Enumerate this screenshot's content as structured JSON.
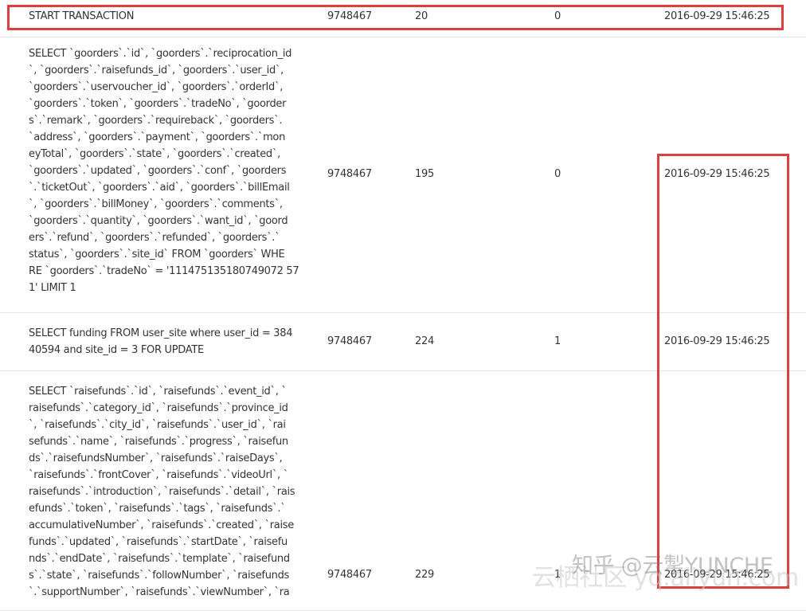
{
  "rows": [
    {
      "sql": [
        "START TRANSACTION"
      ],
      "thread_id": "9748467",
      "time": "20",
      "flag": "0",
      "date": "2016-09-29 15:46:25"
    },
    {
      "sql": [
        "SELECT `goorders`.`id`, `goorders`.`reciprocation_id",
        "`, `goorders`.`raisefunds_id`, `goorders`.`user_id`,",
        "`goorders`.`uservoucher_id`, `goorders`.`orderId`,",
        "`goorders`.`token`, `goorders`.`tradeNo`, `goorder",
        "s`.`remark`, `goorders`.`requireback`, `goorders`.",
        "`address`, `goorders`.`payment`, `goorders`.`mon",
        "eyTotal`, `goorders`.`state`, `goorders`.`created`,",
        "`goorders`.`updated`, `goorders`.`conf`, `goorders",
        "`.`ticketOut`, `goorders`.`aid`, `goorders`.`billEmail",
        "`, `goorders`.`billMoney`, `goorders`.`comments`,",
        "`goorders`.`quantity`, `goorders`.`want_id`, `goord",
        "ers`.`refund`, `goorders`.`refunded`, `goorders`.`",
        "status`, `goorders`.`site_id` FROM `goorders` WHE",
        "RE `goorders`.`tradeNo` = '111475135180749072 57",
        "1' LIMIT 1"
      ],
      "thread_id": "9748467",
      "time": "195",
      "flag": "0",
      "date": "2016-09-29 15:46:25"
    },
    {
      "sql": [
        "SELECT funding FROM user_site where user_id = 384",
        "40594 and site_id = 3 FOR UPDATE"
      ],
      "thread_id": "9748467",
      "time": "224",
      "flag": "1",
      "date": "2016-09-29 15:46:25"
    },
    {
      "sql": [
        "SELECT `raisefunds`.`id`, `raisefunds`.`event_id`, `",
        "raisefunds`.`category_id`, `raisefunds`.`province_id",
        "`, `raisefunds`.`city_id`, `raisefunds`.`user_id`, `rai",
        "sefunds`.`name`, `raisefunds`.`progress`, `raisefun",
        "ds`.`raisefundsNumber`, `raisefunds`.`raiseDays`,",
        "`raisefunds`.`frontCover`, `raisefunds`.`videoUrl`, `",
        "raisefunds`.`introduction`, `raisefunds`.`detail`, `rais",
        "efunds`.`token`, `raisefunds`.`tags`, `raisefunds`.`",
        "accumulativeNumber`, `raisefunds`.`created`, `raise",
        "funds`.`updated`, `raisefunds`.`startDate`, `raisefu",
        "nds`.`endDate`, `raisefunds`.`template`, `raisefund",
        "s`.`state`, `raisefunds`.`followNumber`, `raisefunds",
        "`.`supportNumber`, `raisefunds`.`viewNumber`, `ra"
      ],
      "thread_id": "9748467",
      "time": "229",
      "flag": "1",
      "date": "2016-09-29 15:46:25"
    }
  ],
  "watermark": {
    "zhihu": "知乎 @云掣YUNCHE",
    "yunqi": "云栖社区 yq.aliyun.com"
  },
  "colors": {
    "highlight": "#d9403f"
  }
}
